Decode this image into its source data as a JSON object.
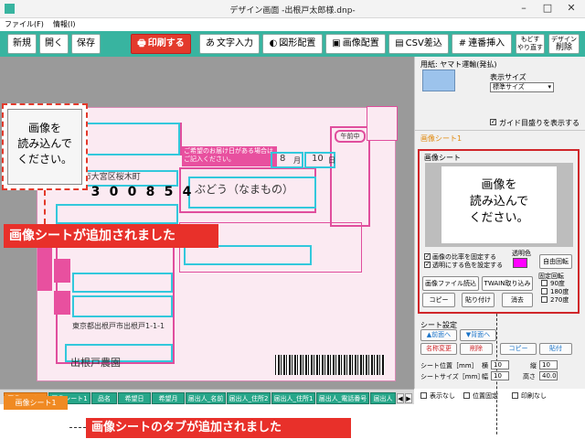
{
  "window": {
    "title": "デザイン画面 -出根戸太郎様.dnp-",
    "minimize": "–",
    "maximize": "□",
    "close": "✕"
  },
  "menu": {
    "file": "ファイル(F)",
    "info": "情報(I)"
  },
  "toolbar": {
    "new": "新規",
    "open": "開く",
    "save": "保存",
    "print": "印刷する",
    "text_input": "文字入力",
    "shape": "図形配置",
    "image": "画像配置",
    "csv": "CSV差込",
    "serial": "連番挿入",
    "modosu": "もどす",
    "yarinaosu": "やり直す",
    "design_delete_top": "デザイン",
    "design_delete": "削除"
  },
  "slip": {
    "digits": [
      "3",
      "0",
      "0",
      "8",
      "5",
      "4"
    ],
    "notice": "ご希望のお届け日がある場合はご記入ください。",
    "month": "8",
    "month_unit": "月",
    "day": "10",
    "day_unit": "日",
    "item": "ぶどう（なまもの）",
    "sender_address": "東京都出根戸市出根戸1-1-1",
    "recipient_partial": "さいたま市大宮区桜木町",
    "sender_name": "出根戸農園",
    "time_slot": "午前中"
  },
  "placeholder": {
    "line1": "画像を",
    "line2": "読み込んで",
    "line3": "ください。"
  },
  "callouts": {
    "added": "画像シートが追加されました",
    "tab_added": "画像シートのタブが追加されました",
    "tab_label": "画像シート1"
  },
  "rpanel": {
    "paper_label": "用紙: ヤマト運輸(発払)",
    "display_size_label": "表示サイズ",
    "display_size_value": "標準サイズ",
    "guide_label": "ガイド目盛りを表示する",
    "section_title": "画像シート1",
    "sheet_label": "画像シート",
    "keep_ratio": "画像の比率を固定する",
    "transparent_set": "透明にする色を設定する",
    "transparent_color_label": "透明色",
    "free_rotate": "自由回転",
    "load_file": "画像ファイル読込",
    "twain": "TWAIN取り込み",
    "copy": "コピー",
    "paste": "貼り付け",
    "erase": "消去",
    "fixed_rotate": "固定回転",
    "rot90": "90度",
    "rot180": "180度",
    "rot270": "270度",
    "sheet_settings": "シート設定",
    "front": "▲前面へ",
    "back": "▼背面へ",
    "rename": "名称変更",
    "delete": "削除",
    "copy2": "コピー",
    "paste2": "貼付",
    "position_label": "シート位置［mm］",
    "size_label": "シートサイズ［mm］",
    "h_label": "横",
    "v_label": "縦",
    "w_label": "幅",
    "ht_label": "高さ",
    "pos_x": "10",
    "pos_y": "10",
    "width": "10",
    "height": "40.0",
    "no_display": "表示なし",
    "pos_fixed": "位置固定",
    "no_print": "印刷なし"
  },
  "tabs": [
    "画像シート1",
    "画像シート1",
    "品名",
    "希望日",
    "希望月",
    "届出人_名前",
    "届出人_住所2",
    "届出人_住所1",
    "届出人_電話番号",
    "届出人"
  ],
  "colors": {
    "toolbar": "#38b4a0",
    "accent_red": "#e8302a",
    "tab_green": "#26a689",
    "tab_selected": "#f08a23",
    "slip_pink": "#e04e9d",
    "field_cyan": "#32c8dc",
    "transparent_swatch": "#ff00ff"
  }
}
